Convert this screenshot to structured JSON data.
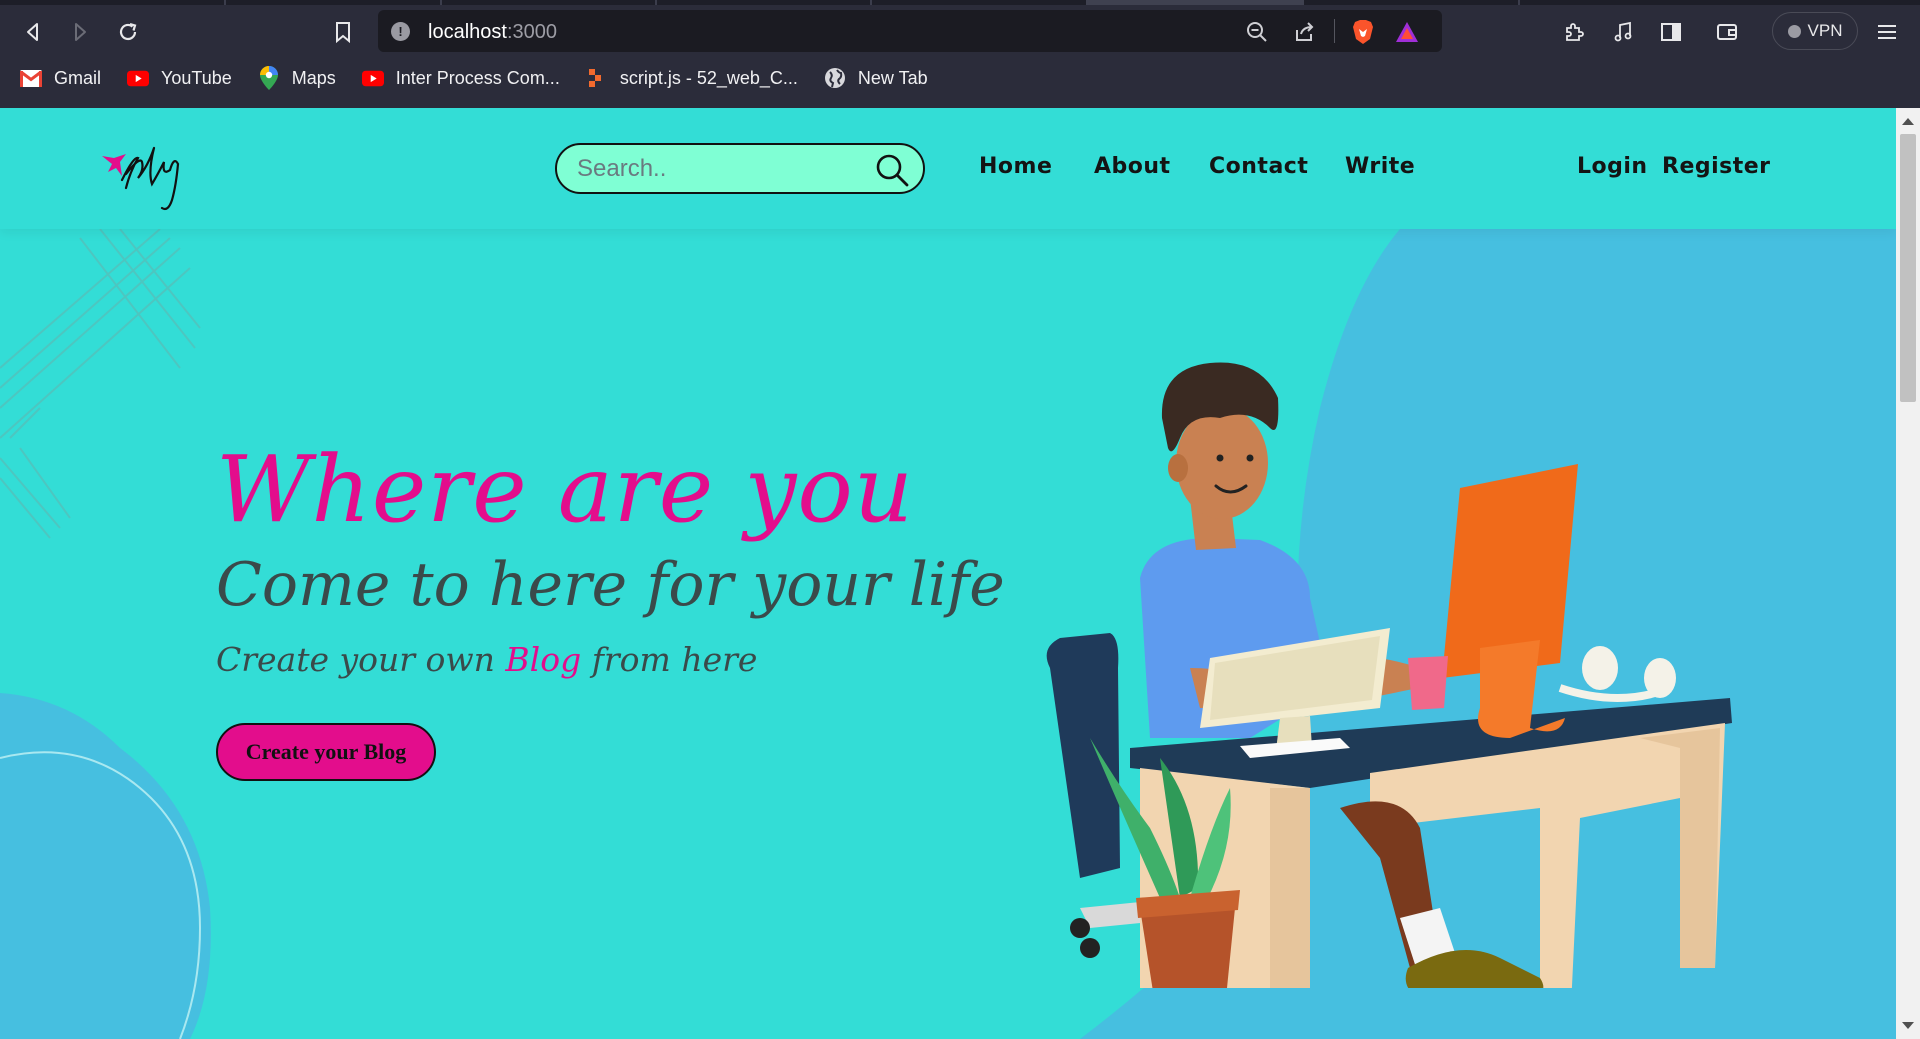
{
  "browser": {
    "url_host": "localhost",
    "url_port": ":3000",
    "vpn_label": "VPN",
    "bookmarks": [
      {
        "label": "Gmail",
        "icon": "gmail-icon"
      },
      {
        "label": "YouTube",
        "icon": "youtube-icon"
      },
      {
        "label": "Maps",
        "icon": "maps-icon"
      },
      {
        "label": "Inter Process Com...",
        "icon": "youtube-icon"
      },
      {
        "label": "script.js - 52_web_C...",
        "icon": "code-icon"
      },
      {
        "label": "New Tab",
        "icon": "globe-icon"
      }
    ]
  },
  "site": {
    "search_placeholder": "Search..",
    "nav": {
      "home": "Home",
      "about": "About",
      "contact": "Contact",
      "write": "Write",
      "login": "Login",
      "register": "Register"
    },
    "hero": {
      "title": "Where are you",
      "subtitle": "Come to here for your life",
      "tagline_before": "Create your own ",
      "tagline_highlight": "Blog",
      "tagline_after": " from here",
      "cta": "Create your Blog"
    },
    "colors": {
      "background": "#33ddd6",
      "accent": "#e30d8c",
      "search_bg": "#7fffd4",
      "blob": "#46bfe0"
    }
  }
}
